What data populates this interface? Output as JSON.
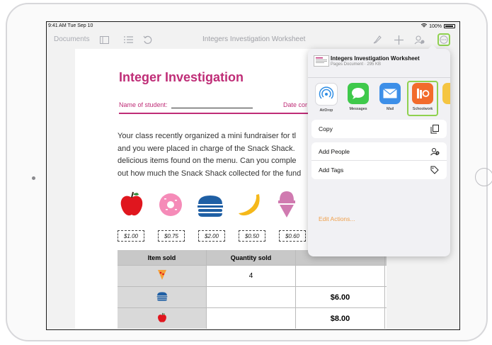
{
  "status_bar": {
    "time": "9:41 AM  Tue Sep 10",
    "battery": "100%"
  },
  "toolbar": {
    "documents_label": "Documents",
    "title": "Integers Investigation Worksheet"
  },
  "doc": {
    "title": "Integer Investigation",
    "name_label": "Name of student:",
    "date_label": "Date cor",
    "paragraph_lines": [
      "Your class recently organized a mini fundraiser for tl",
      "and you were placed in charge of the Snack Shack.",
      "delicious items found on the menu. Can you comple",
      "out how much the Snack Shack collected for the fund"
    ],
    "prices": [
      "$1.00",
      "$0.75",
      "$2.00",
      "$0.50",
      "$0.60"
    ],
    "food_icons": [
      "apple-icon",
      "donut-icon",
      "burger-icon",
      "banana-icon",
      "icecream-icon"
    ],
    "table": {
      "headers": [
        "Item sold",
        "Quantity sold",
        ""
      ],
      "rows": [
        {
          "icon": "pizza-icon",
          "quantity": "4",
          "total": ""
        },
        {
          "icon": "burger-icon",
          "quantity": "",
          "total": "$6.00"
        },
        {
          "icon": "apple-icon",
          "quantity": "",
          "total": "$8.00"
        }
      ]
    }
  },
  "share_sheet": {
    "title": "Integers Investigation Worksheet",
    "subtitle": "Pages Document · 295 KB",
    "apps": [
      "AirDrop",
      "Messages",
      "Mail",
      "Schoolwork"
    ],
    "copy_label": "Copy",
    "add_people_label": "Add People",
    "add_tags_label": "Add Tags",
    "edit_actions_label": "Edit Actions..."
  },
  "colors": {
    "accent_pink": "#bf2d77",
    "highlight_green": "#8fd14f",
    "edit_orange": "#f0a04b"
  }
}
